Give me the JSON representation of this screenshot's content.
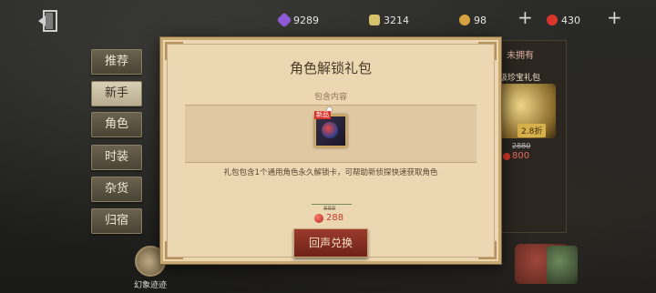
{
  "topbar": {
    "exit_icon": "exit-door-icon",
    "currencies": [
      {
        "name": "purple-crystal",
        "value": "9289",
        "color": "#8f5bd6"
      },
      {
        "name": "puzzle-piece",
        "value": "3214",
        "color": "#d8c26a"
      },
      {
        "name": "gold-coin",
        "value": "98",
        "color": "#d9a441"
      },
      {
        "name": "red-gem",
        "value": "430",
        "color": "#d8352b"
      }
    ],
    "plus_label": "+"
  },
  "side_tabs": [
    {
      "label": "推荐"
    },
    {
      "label": "新手"
    },
    {
      "label": "角色"
    },
    {
      "label": "时装"
    },
    {
      "label": "杂货"
    },
    {
      "label": "归宿"
    }
  ],
  "active_side_tab": "新手",
  "dream_label": "幻象迹迹",
  "right_panel": {
    "tab_label": "未拥有",
    "card_title": "级珍宝礼包",
    "discount": "2.8折",
    "old_price": "2880",
    "price": "800"
  },
  "dialog": {
    "title": "角色解锁礼包",
    "section_label": "包含内容",
    "item_tag": "新品",
    "description": "礼包包含1个通用角色永久解锁卡，可帮助新侦探快速获取角色",
    "old_price": "888",
    "price": "288",
    "button_label": "回声兑换"
  },
  "colors": {
    "dialog_bg": "#ecd7b3",
    "accent_red": "#c23b2e",
    "button_bg": "#7f2a1f"
  }
}
